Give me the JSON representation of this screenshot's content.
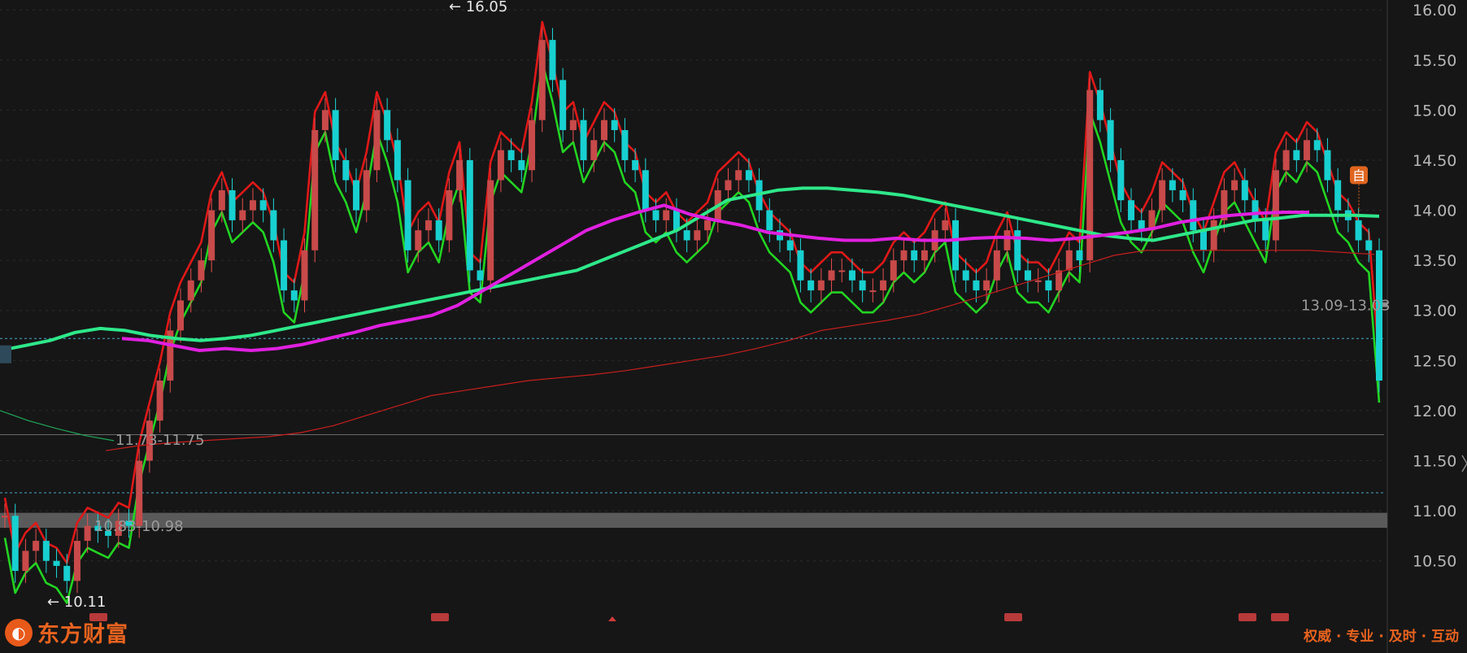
{
  "brand": {
    "name": "东方财富",
    "logo_glyph": "◐",
    "tagline": "权威 · 专业 · 及时 · 互动"
  },
  "chart_data": {
    "type": "candlestick",
    "title": "",
    "ylim": [
      10.1,
      16.1
    ],
    "y_ticks": [
      "16.00",
      "15.50",
      "15.00",
      "14.50",
      "14.00",
      "13.50",
      "13.00",
      "12.50",
      "12.00",
      "11.50",
      "11.00",
      "10.50"
    ],
    "y_tick_values": [
      16.0,
      15.5,
      15.0,
      14.5,
      14.0,
      13.5,
      13.0,
      12.5,
      12.0,
      11.5,
      11.0,
      10.5
    ],
    "high_label": "16.05",
    "low_label": "10.11",
    "high_value": 16.05,
    "low_value": 10.11,
    "zones": [
      {
        "label": "10.83-10.98",
        "low": 10.83,
        "high": 10.98
      },
      {
        "label": "11.73-11.75",
        "low": 11.73,
        "high": 11.75
      },
      {
        "label": "13.09-13.03",
        "low": 13.03,
        "high": 13.09
      }
    ],
    "dashed_levels": [
      12.72,
      11.18
    ],
    "solid_level": 11.76,
    "self_marker": "自",
    "close_series": [
      10.95,
      10.4,
      10.6,
      10.7,
      10.5,
      10.45,
      10.3,
      10.7,
      10.85,
      10.8,
      10.75,
      10.9,
      10.85,
      11.5,
      11.9,
      12.3,
      12.8,
      13.1,
      13.3,
      13.5,
      14.0,
      14.2,
      13.9,
      14.0,
      14.1,
      14.0,
      13.7,
      13.2,
      13.1,
      13.6,
      14.8,
      15.0,
      14.5,
      14.3,
      14.0,
      14.4,
      15.0,
      14.7,
      14.3,
      13.6,
      13.8,
      13.9,
      13.7,
      14.2,
      14.5,
      13.4,
      13.3,
      14.3,
      14.6,
      14.5,
      14.4,
      14.9,
      15.7,
      15.3,
      14.8,
      14.9,
      14.5,
      14.7,
      14.9,
      14.8,
      14.5,
      14.4,
      14.0,
      13.9,
      14.0,
      13.8,
      13.7,
      13.8,
      13.9,
      14.2,
      14.3,
      14.4,
      14.3,
      14.0,
      13.8,
      13.7,
      13.6,
      13.3,
      13.2,
      13.3,
      13.4,
      13.4,
      13.3,
      13.2,
      13.2,
      13.3,
      13.5,
      13.6,
      13.5,
      13.6,
      13.8,
      13.9,
      13.4,
      13.3,
      13.2,
      13.3,
      13.6,
      13.8,
      13.4,
      13.3,
      13.3,
      13.2,
      13.4,
      13.6,
      13.5,
      15.2,
      14.9,
      14.5,
      14.1,
      13.9,
      13.8,
      14.0,
      14.3,
      14.2,
      14.1,
      13.8,
      13.6,
      13.9,
      14.2,
      14.3,
      14.1,
      13.9,
      13.7,
      14.4,
      14.6,
      14.5,
      14.7,
      14.6,
      14.3,
      14.0,
      13.9,
      13.7,
      13.6,
      12.3
    ],
    "ma_series": [
      {
        "name": "",
        "color": "#2ee88a",
        "values": [
          12.6,
          12.65,
          12.7,
          12.78,
          12.82,
          12.8,
          12.75,
          12.72,
          12.7,
          12.72,
          12.75,
          12.8,
          12.85,
          12.9,
          12.95,
          13.0,
          13.05,
          13.1,
          13.15,
          13.2,
          13.25,
          13.3,
          13.35,
          13.4,
          13.5,
          13.6,
          13.7,
          13.8,
          13.95,
          14.1,
          14.15,
          14.2,
          14.22,
          14.22,
          14.2,
          14.18,
          14.15,
          14.1,
          14.05,
          14.0,
          13.95,
          13.9,
          13.85,
          13.8,
          13.75,
          13.72,
          13.7,
          13.75,
          13.8,
          13.85,
          13.9,
          13.92,
          13.95,
          13.95,
          13.95,
          13.94
        ]
      },
      {
        "name": "",
        "color": "#e020e0",
        "values": [
          12.72,
          12.7,
          12.65,
          12.6,
          12.62,
          12.6,
          12.62,
          12.66,
          12.72,
          12.78,
          12.85,
          12.9,
          12.95,
          13.05,
          13.2,
          13.35,
          13.5,
          13.65,
          13.8,
          13.9,
          13.98,
          14.05,
          13.96,
          13.9,
          13.85,
          13.78,
          13.75,
          13.72,
          13.7,
          13.7,
          13.72,
          13.7,
          13.7,
          13.72,
          13.73,
          13.72,
          13.7,
          13.72,
          13.75,
          13.78,
          13.82,
          13.88,
          13.92,
          13.95,
          13.97,
          13.98,
          13.98
        ]
      },
      {
        "name": "",
        "color": "#c81e1e",
        "values": [
          11.6,
          11.65,
          11.68,
          11.7,
          11.72,
          11.74,
          11.78,
          11.85,
          11.95,
          12.05,
          12.15,
          12.2,
          12.25,
          12.3,
          12.33,
          12.36,
          12.4,
          12.45,
          12.5,
          12.55,
          12.62,
          12.7,
          12.8,
          12.85,
          12.9,
          12.96,
          13.05,
          13.15,
          13.25,
          13.35,
          13.45,
          13.55,
          13.6,
          13.6,
          13.6,
          13.6,
          13.6,
          13.6,
          13.58,
          13.56
        ]
      },
      {
        "name": "",
        "color": "#1fa85a",
        "values": [
          12.0,
          11.9,
          11.82,
          11.75,
          11.7
        ]
      }
    ]
  },
  "bottom_markers": [
    "x1",
    "x2",
    "x3",
    "x4",
    "x5",
    "x6"
  ]
}
